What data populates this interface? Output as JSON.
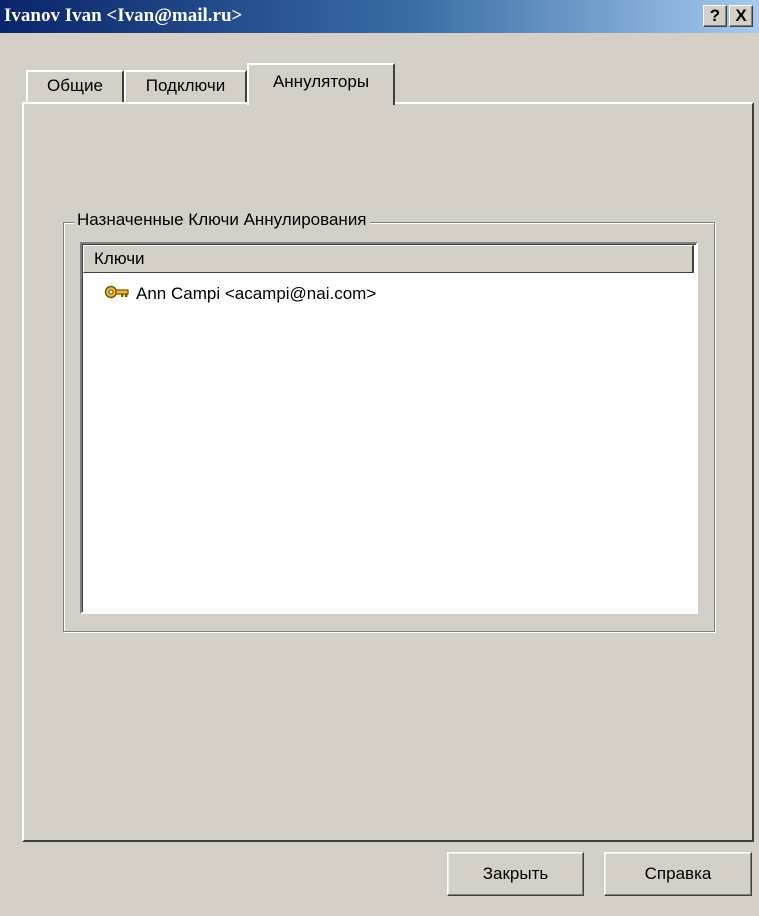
{
  "window": {
    "title": "Ivanov Ivan <Ivan@mail.ru>",
    "help_button": "?",
    "close_button": "X"
  },
  "tabs": [
    {
      "label": "Общие",
      "active": false
    },
    {
      "label": "Подключи",
      "active": false
    },
    {
      "label": "Аннуляторы",
      "active": true
    }
  ],
  "revokers_group": {
    "label": "Назначенные Ключи Аннулирования",
    "column_header": "Ключи",
    "rows": [
      {
        "icon": "key-icon",
        "text": "Ann Campi <acampi@nai.com>"
      }
    ]
  },
  "buttons": {
    "close": "Закрыть",
    "help": "Справка"
  },
  "colors": {
    "titlebar_start": "#0a246a",
    "titlebar_end": "#a6caf0",
    "face": "#d4d0c8",
    "key_gold": "#d8a020"
  }
}
